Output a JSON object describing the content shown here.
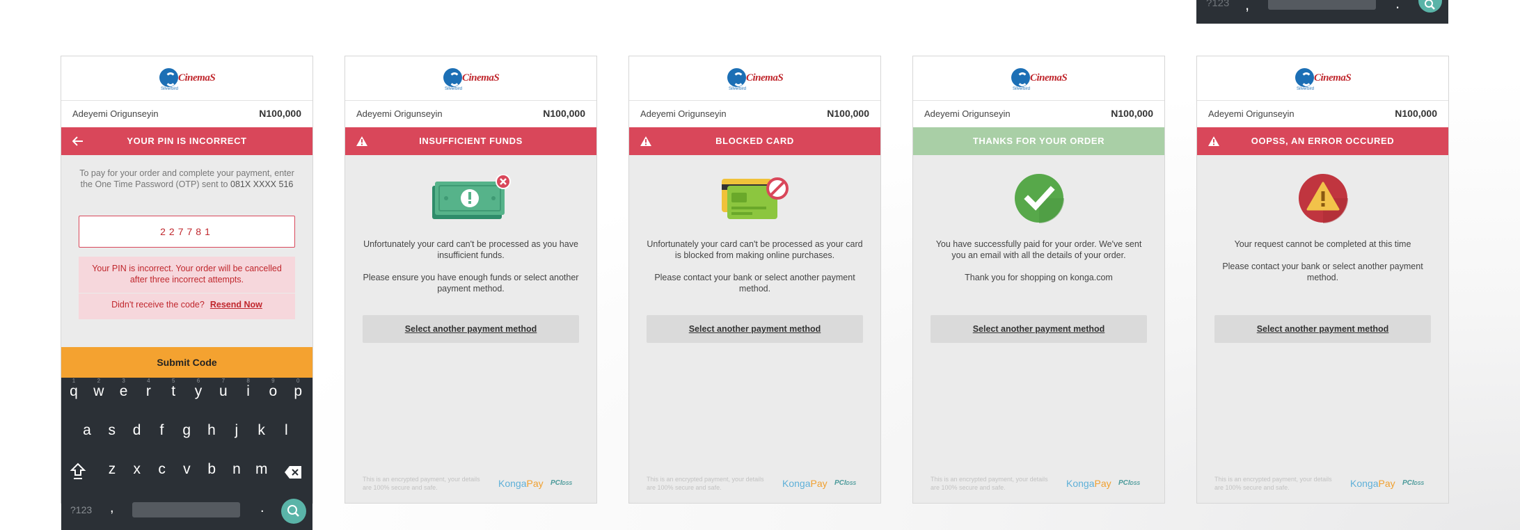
{
  "logo": {
    "word": "CinemaS",
    "sub": "Silverbird"
  },
  "order": {
    "customer": "Adeyemi Origunseyin",
    "amount": "N100,000"
  },
  "keyboard": {
    "row1": [
      "q",
      "w",
      "e",
      "r",
      "t",
      "y",
      "u",
      "i",
      "o",
      "p"
    ],
    "row1_hints": [
      "1",
      "2",
      "3",
      "4",
      "5",
      "6",
      "7",
      "8",
      "9",
      "0"
    ],
    "row2": [
      "a",
      "s",
      "d",
      "f",
      "g",
      "h",
      "j",
      "k",
      "l"
    ],
    "row3": [
      "z",
      "x",
      "c",
      "v",
      "b",
      "n",
      "m"
    ],
    "mode_key": "?123",
    "comma_key": ",",
    "period_key": ".",
    "accent": "#5ab4a8"
  },
  "panels": {
    "pin": {
      "status": "YOUR PIN IS INCORRECT",
      "otp_instructions": "To pay for your order and complete your payment, enter the One Time Password (OTP) sent to",
      "phone": "081X XXXX 516",
      "otp_value": "227781",
      "error": "Your PIN is incorrect. Your order will be cancelled after three incorrect attempts.",
      "resend_prompt": "Didn't receive the code?",
      "resend_link": "Resend Now",
      "submit": "Submit Code"
    },
    "funds": {
      "status": "INSUFFICIENT FUNDS",
      "msg1": "Unfortunately your card can't be processed as you have insufficient funds.",
      "msg2": "Please ensure you have enough funds or select another payment method.",
      "button": "Select another payment method"
    },
    "blocked": {
      "status": "BLOCKED CARD",
      "msg1": "Unfortunately your card can't be processed as your card is blocked from making online purchases.",
      "msg2": "Please contact your bank or select another payment method.",
      "button": "Select another payment method"
    },
    "thanks": {
      "status": "THANKS FOR YOUR ORDER",
      "msg1": "You have successfully paid for your order. We've sent you an email with all the details of your order.",
      "msg2": "Thank you for shopping on konga.com",
      "button": "Select another payment method"
    },
    "error": {
      "status": "OOPSS, AN ERROR OCCURED",
      "msg1": "Your request cannot be completed at this time",
      "msg2": "Please contact your bank or select another payment method.",
      "button": "Select another payment method"
    }
  },
  "footer": {
    "fine_print": "This is an encrypted payment, your details are 100% secure and safe.",
    "brand_a": "Konga",
    "brand_b": "Pay",
    "pci": "PCI",
    "pci_sub": "DSS"
  },
  "colors": {
    "error_red": "#d9475a",
    "success_green": "#a9cfa6",
    "submit_orange": "#f4a230",
    "keyboard_bg": "#2b3036"
  }
}
